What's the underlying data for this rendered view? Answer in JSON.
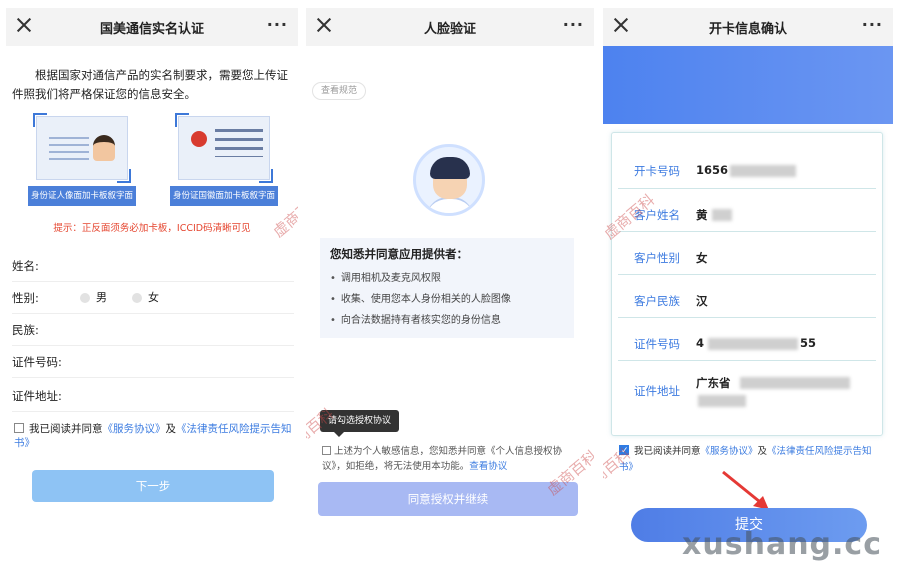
{
  "panel1": {
    "title": "国美通信实名认证",
    "more": "···",
    "intro": "根据国家对通信产品的实名制要求，需要您上传证件照我们将严格保证您的信息安全。",
    "card_front_caption": "身份证人像面加卡板叙字面",
    "card_back_caption": "身份证国徽面加卡板叙字面",
    "hint": "提示：正反面须务必加卡板，ICCID码清晰可见",
    "fields": {
      "name": "姓名:",
      "gender": "性别:",
      "male": "男",
      "female": "女",
      "ethnicity": "民族:",
      "id_number": "证件号码:",
      "address": "证件地址:"
    },
    "agree_prefix": "我已阅读并同意",
    "service_link": "《服务协议》",
    "and": "及",
    "legal_link": "《法律责任风险提示告知书》",
    "next_button": "下一步",
    "watermark": "虚商百科"
  },
  "panel2": {
    "title": "人脸验证",
    "more": "···",
    "view_spec": "查看规范",
    "consent_title": "您知悉并同意应用提供者：",
    "consent_items": [
      "调用相机及麦克风权限",
      "收集、使用您本人身份相关的人脸图像",
      "向合法数据持有者核实您的身份信息"
    ],
    "tooltip": "请勾选授权协议",
    "agree_text": "上述为个人敏感信息，您知悉并同意《个人信息授权协议》，如拒绝，将无法使用本功能。",
    "view_protocol": "查看协议",
    "agree_button": "同意授权并继续",
    "watermark": "虚商百科"
  },
  "panel3": {
    "title": "开卡信息确认",
    "more": "···",
    "rows": [
      {
        "label": "开卡号码",
        "value": "1656"
      },
      {
        "label": "客户姓名",
        "value": "黄"
      },
      {
        "label": "客户性别",
        "value": "女"
      },
      {
        "label": "客户民族",
        "value": "汉"
      },
      {
        "label": "证件号码",
        "value": "4"
      },
      {
        "label": "证件地址",
        "value": "广东省"
      }
    ],
    "id_tail": "55",
    "agree_prefix": "我已阅读并同意",
    "service_link": "《服务协议》",
    "and": "及",
    "legal_link": "《法律责任风险提示告知书》",
    "submit_button": "提交",
    "watermark": "虚商百科"
  },
  "brand_watermark": "xushang.cc",
  "colors": {
    "accent_blue": "#3b7be0",
    "button_light_blue": "#8ec3f4",
    "button_periwinkle": "#a8b9f3",
    "hint_red": "#e5452f",
    "arrow_red": "#e53935"
  }
}
